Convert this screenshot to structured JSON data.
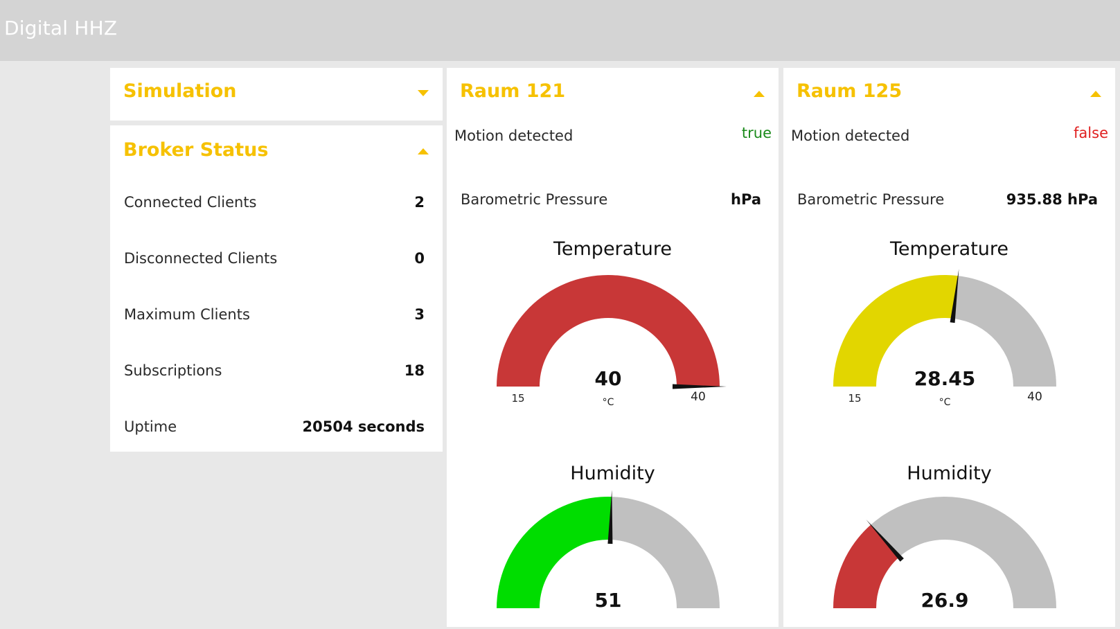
{
  "app": {
    "title": "Digital HHZ"
  },
  "simulation": {
    "title": "Simulation"
  },
  "broker": {
    "title": "Broker Status",
    "rows": [
      {
        "label": "Connected Clients",
        "value": "2"
      },
      {
        "label": "Disconnected Clients",
        "value": "0"
      },
      {
        "label": "Maximum Clients",
        "value": "3"
      },
      {
        "label": "Subscriptions",
        "value": "18"
      },
      {
        "label": "Uptime",
        "value": "20504 seconds"
      }
    ]
  },
  "rooms": [
    {
      "title": "Raum 121",
      "motion": {
        "label": "Motion detected",
        "value": "true",
        "color": "#1a8a1a"
      },
      "pressure": {
        "label": "Barometric Pressure",
        "value": "hPa"
      },
      "temperature": {
        "title": "Temperature",
        "value": "40",
        "unit": "°C",
        "min": "15",
        "max": "40",
        "fill_fraction": 1.0,
        "color": "#c83737"
      },
      "humidity": {
        "title": "Humidity",
        "value": "51",
        "fill_fraction": 0.51,
        "color": "#00dd00"
      }
    },
    {
      "title": "Raum 125",
      "motion": {
        "label": "Motion detected",
        "value": "false",
        "color": "#e02020"
      },
      "pressure": {
        "label": "Barometric Pressure",
        "value": "935.88 hPa"
      },
      "temperature": {
        "title": "Temperature",
        "value": "28.45",
        "unit": "°C",
        "min": "15",
        "max": "40",
        "fill_fraction": 0.538,
        "color": "#e2d600"
      },
      "humidity": {
        "title": "Humidity",
        "value": "26.9",
        "fill_fraction": 0.269,
        "color": "#c83737"
      }
    }
  ],
  "colors": {
    "accent": "#f6c100",
    "gauge_track": "#c0c0c0",
    "needle": "#111111"
  }
}
